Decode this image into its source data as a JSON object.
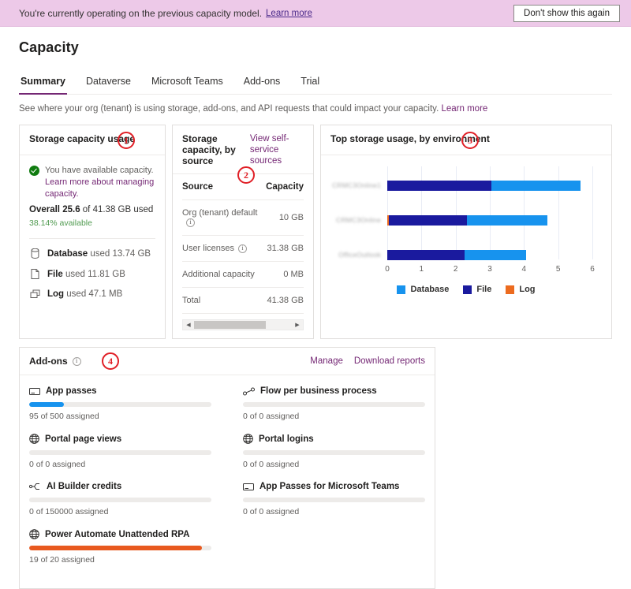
{
  "banner": {
    "text": "You're currently operating on the previous capacity model.",
    "link": "Learn more",
    "button": "Don't show this again",
    "bg": "#edc9e8"
  },
  "header": {
    "title": "Capacity",
    "subtitle": "See where your org (tenant) is using storage, add-ons, and API requests that could impact your capacity.",
    "subtitle_link": "Learn more"
  },
  "tabs": [
    {
      "label": "Summary",
      "active": true
    },
    {
      "label": "Dataverse",
      "active": false
    },
    {
      "label": "Microsoft Teams",
      "active": false
    },
    {
      "label": "Add-ons",
      "active": false
    },
    {
      "label": "Trial",
      "active": false
    }
  ],
  "annotations": [
    "1",
    "2",
    "3",
    "4"
  ],
  "storage_usage": {
    "title": "Storage capacity usage",
    "status_icon": "check-circle-icon",
    "status_text": "You have available capacity. ",
    "status_link": "Learn more about managing capacity.",
    "overall_prefix": "Overall ",
    "overall_value": "25.6",
    "overall_suffix": " of 41.38 GB used",
    "available": "38.14% available",
    "items": [
      {
        "icon": "database-icon",
        "name": "Database",
        "detail": " used 13.74 GB"
      },
      {
        "icon": "file-icon",
        "name": "File",
        "detail": " used 11.81 GB"
      },
      {
        "icon": "log-icon",
        "name": "Log",
        "detail": " used 47.1 MB"
      }
    ]
  },
  "capacity_by_source": {
    "title": "Storage capacity, by source",
    "link": "View self-service sources",
    "columns": [
      "Source",
      "Capacity"
    ],
    "rows": [
      {
        "source": "Org (tenant) default",
        "info": true,
        "capacity": "10 GB"
      },
      {
        "source": "User licenses",
        "info": true,
        "capacity": "31.38 GB"
      },
      {
        "source": "Additional capacity",
        "info": false,
        "capacity": "0 MB"
      },
      {
        "source": "Total",
        "info": false,
        "capacity": "41.38 GB"
      }
    ]
  },
  "chart_data": {
    "type": "bar",
    "orientation": "horizontal",
    "stacked": true,
    "title": "Top storage usage, by environment",
    "xlabel": "",
    "ylabel": "",
    "xlim": [
      0,
      6
    ],
    "xticks": [
      0,
      1,
      2,
      3,
      4,
      5,
      6
    ],
    "grid": true,
    "legend_position": "bottom",
    "categories": [
      "CRMC3Online1",
      "CRMC3Online",
      "OfficeOutlook"
    ],
    "categories_blurred": true,
    "series": [
      {
        "name": "Log",
        "color": "#ec6b1f",
        "values": [
          0,
          0.04,
          0
        ]
      },
      {
        "name": "File",
        "color": "#1a1a9e",
        "values": [
          3.05,
          2.3,
          2.25
        ]
      },
      {
        "name": "Database",
        "color": "#1793ee",
        "values": [
          2.6,
          2.35,
          1.8
        ]
      }
    ],
    "legend": [
      {
        "label": "Database",
        "color": "#1793ee"
      },
      {
        "label": "File",
        "color": "#1a1a9e"
      },
      {
        "label": "Log",
        "color": "#ec6b1f"
      }
    ]
  },
  "addons": {
    "title": "Add-ons",
    "info_icon": "info-icon",
    "actions": [
      "Manage",
      "Download reports"
    ],
    "items": [
      {
        "icon": "app-passes-icon",
        "label": "App passes",
        "sub": "95 of 500 assigned",
        "pct": 19,
        "color": "#1793ee"
      },
      {
        "icon": "flow-icon",
        "label": "Flow per business process",
        "sub": "0 of 0 assigned",
        "pct": 0,
        "color": "#1793ee"
      },
      {
        "icon": "globe-icon",
        "label": "Portal page views",
        "sub": "0 of 0 assigned",
        "pct": 0,
        "color": "#1793ee"
      },
      {
        "icon": "globe-icon",
        "label": "Portal logins",
        "sub": "0 of 0 assigned",
        "pct": 0,
        "color": "#1793ee"
      },
      {
        "icon": "ai-builder-icon",
        "label": "AI Builder credits",
        "sub": "0 of 150000 assigned",
        "pct": 0,
        "color": "#1793ee"
      },
      {
        "icon": "app-passes-icon",
        "label": "App Passes for Microsoft Teams",
        "sub": "0 of 0 assigned",
        "pct": 0,
        "color": "#1793ee"
      },
      {
        "icon": "globe-icon",
        "label": "Power Automate Unattended RPA",
        "sub": "19 of 20 assigned",
        "pct": 95,
        "color": "#e8591f"
      }
    ]
  }
}
